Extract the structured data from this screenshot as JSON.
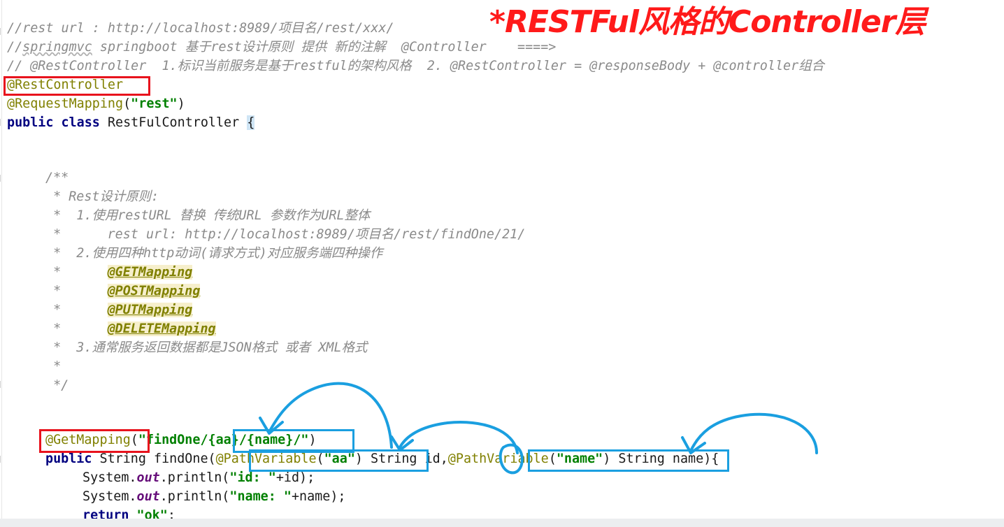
{
  "title": "*RESTFul风格的Controller层",
  "header_comments": {
    "line1": "//rest url : http://localhost:8989/项目名/rest/xxx/",
    "line2_a": "//",
    "line2_b": "springmvc",
    "line2_c": " springboot 基于rest设计原则 提供 新的注解  @Controller    ====>",
    "line3": "// @RestController  1.标识当前服务是基于restful的架构风格  2. @RestController = @responseBody + @controller组合"
  },
  "class_decl": {
    "annotation_rest": "@RestController",
    "request_mapping_ann": "@RequestMapping",
    "request_mapping_open": "(",
    "request_mapping_value": "\"rest\"",
    "request_mapping_close": ")",
    "kw_public": "public",
    "kw_class": "class",
    "class_name": "RestFulController",
    "open_brace": "{"
  },
  "javadoc": {
    "open": "/**",
    "l1_star": " * ",
    "l1_text": "Rest设计原则:",
    "l2_star": " *  ",
    "l2_text": "1.使用restURL 替换 传统URL 参数作为URL整体",
    "l3_star": " *      ",
    "l3_text": "rest url: http://localhost:8989/项目名/rest/findOne/21/",
    "l4_star": " *  ",
    "l4_text": "2.使用四种http动词(请求方式)对应服务端四种操作",
    "mapping_star": " *      ",
    "mappings": [
      "@GETMapping",
      "@POSTMapping",
      "@PUTMapping",
      "@DELETEMapping"
    ],
    "l9_star": " *  ",
    "l9_text": "3.通常服务返回数据都是JSON格式 或者 XML格式",
    "l10": " *",
    "close": " */"
  },
  "method": {
    "get_mapping_ann": "@GetMapping",
    "get_mapping_open": "(",
    "get_mapping_value_a": "\"findOne",
    "get_mapping_value_b": "/{aa}/{name}/",
    "get_mapping_value_c": "\"",
    "get_mapping_close": ")",
    "kw_public": "public",
    "return_type": " String findOne(",
    "pathvar1_ann": "@PathVariable",
    "pathvar1_open": "(",
    "pathvar1_value": "\"aa\"",
    "pathvar1_close": ")",
    "param1_type": " String ",
    "param1_name": "id",
    "param_sep": ",",
    "pathvar2_ann": "@PathVariable",
    "pathvar2_open": "(",
    "pathvar2_value": "\"name\"",
    "pathvar2_close": ")",
    "param2": " String name){",
    "body1_a": "System.",
    "body1_field": "out",
    "body1_b": ".println(",
    "body1_str": "\"id: \"",
    "body1_c": "+id);",
    "body2_a": "System.",
    "body2_field": "out",
    "body2_b": ".println(",
    "body2_str": "\"name: \"",
    "body2_c": "+name);",
    "body3_kw": "return",
    "body3_str": " \"ok\"",
    "body3_end": ";"
  },
  "colors": {
    "title_red": "#ff1a1a",
    "box_red": "#e8131d",
    "box_blue": "#1a9fe0",
    "arrow_blue": "#1a9fe0"
  },
  "icons": [
    "arrow-annotation-icon"
  ]
}
